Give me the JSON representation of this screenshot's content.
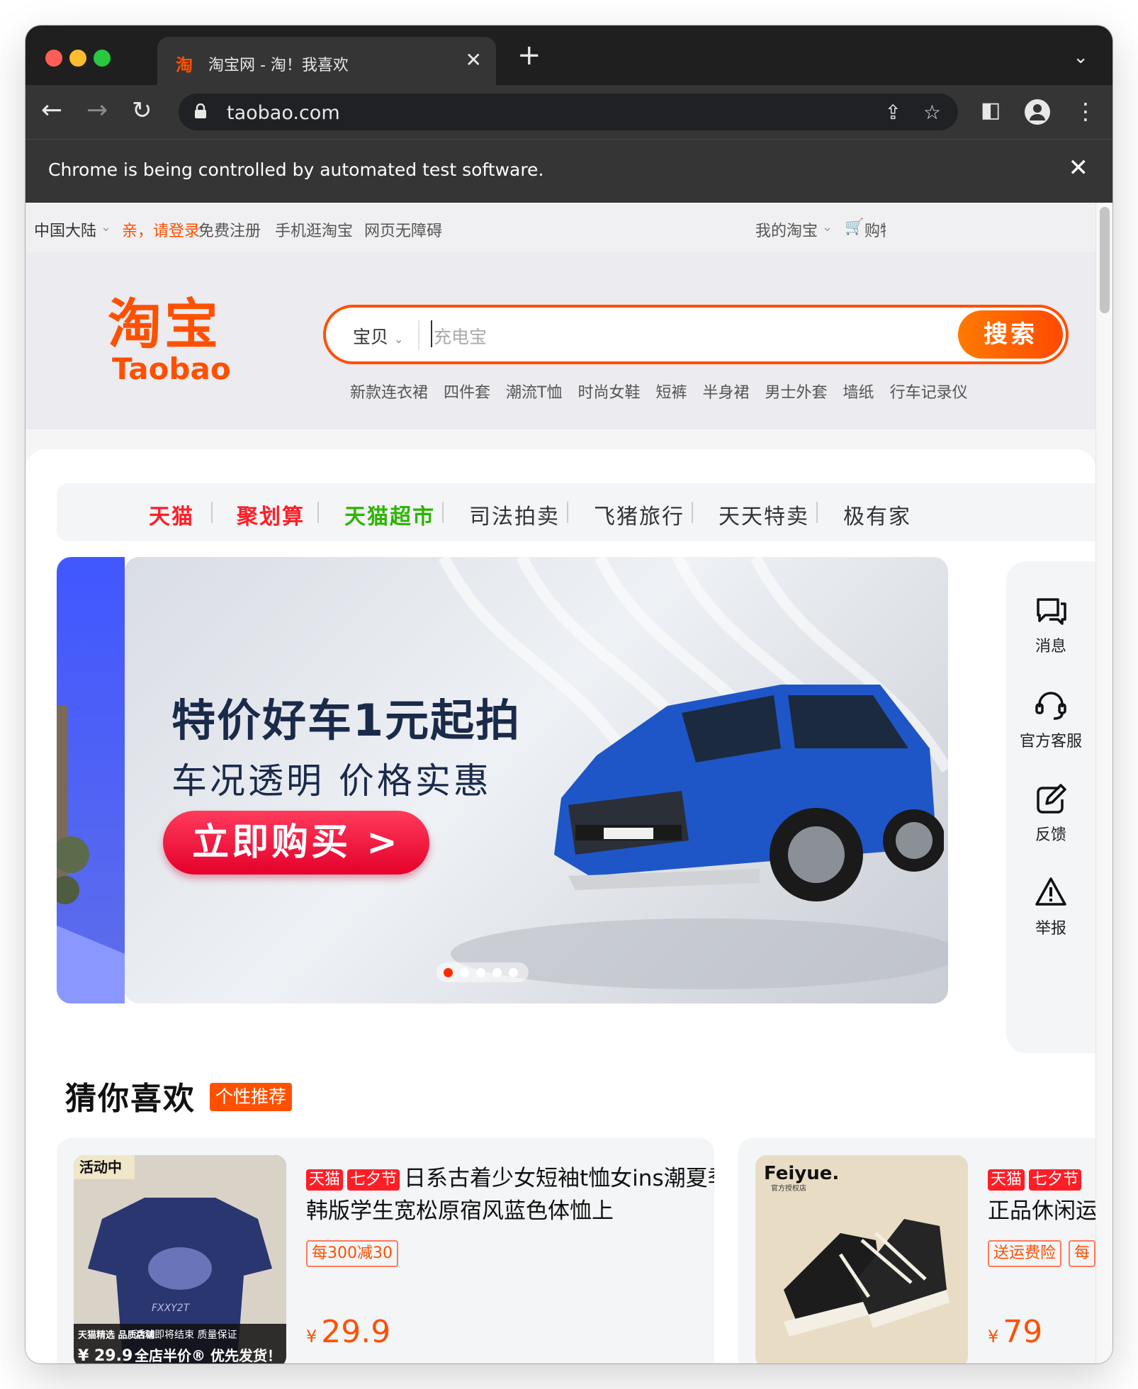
{
  "browser": {
    "tab_title": "淘宝网 - 淘！我喜欢",
    "tab_favicon": "淘",
    "url": "taobao.com",
    "infobar_message": "Chrome is being controlled by automated test software."
  },
  "sitenav": {
    "region": "中国大陆",
    "login": "亲，请登录",
    "register": "免费注册",
    "mobile": "手机逛淘宝",
    "accessibility": "网页无障碍",
    "my_taobao": "我的淘宝",
    "cart": "购物车"
  },
  "header": {
    "logo_cn": "淘宝",
    "logo_en": "Taobao",
    "search": {
      "category": "宝贝",
      "placeholder": "充电宝",
      "button": "搜索"
    },
    "hotwords": [
      "新款连衣裙",
      "四件套",
      "潮流T恤",
      "时尚女鞋",
      "短裤",
      "半身裙",
      "男士外套",
      "墙纸",
      "行车记录仪"
    ]
  },
  "channels": [
    {
      "label": "天猫",
      "color": "#ff1e26"
    },
    {
      "label": "聚划算",
      "color": "#ff1e26"
    },
    {
      "label": "天猫超市",
      "color": "#2db400"
    },
    {
      "label": "司法拍卖",
      "color": "#333333"
    },
    {
      "label": "飞猪旅行",
      "color": "#333333"
    },
    {
      "label": "天天特卖",
      "color": "#333333"
    },
    {
      "label": "极有家",
      "color": "#333333"
    }
  ],
  "banner": {
    "headline": "特价好车1元起拍",
    "subline": "车况透明 价格实惠",
    "cta": "立即购买 >",
    "slide_count": 5,
    "active_slide": 1
  },
  "floatbar": {
    "messages": "消息",
    "service": "官方客服",
    "feedback": "反馈",
    "report": "举报"
  },
  "guess": {
    "title": "猜你喜欢",
    "tag": "个性推荐"
  },
  "products": [
    {
      "badges": [
        "天猫",
        "七夕节"
      ],
      "title": "日系古着少女短袖t恤女ins潮夏季韩版学生宽松原宿风蓝色体恤上",
      "coupons": [
        "每300减30"
      ],
      "currency": "¥",
      "price": "29.9",
      "image_label": "活动中",
      "image_caption_1": "天猫精选 品质店铺",
      "image_caption_2": "活动即将结束 质量保证",
      "image_price": "¥ 29.9",
      "image_promo": "全店半价® 优先发货！",
      "image_print": "FXXY2T"
    },
    {
      "badges": [
        "天猫",
        "七夕节"
      ],
      "title": "正品休闲运动鞋",
      "coupons": [
        "送运费险",
        "每"
      ],
      "currency": "¥",
      "price": "79",
      "image_brand": "Feiyue.",
      "image_brand_sub": "官方授权店"
    }
  ]
}
